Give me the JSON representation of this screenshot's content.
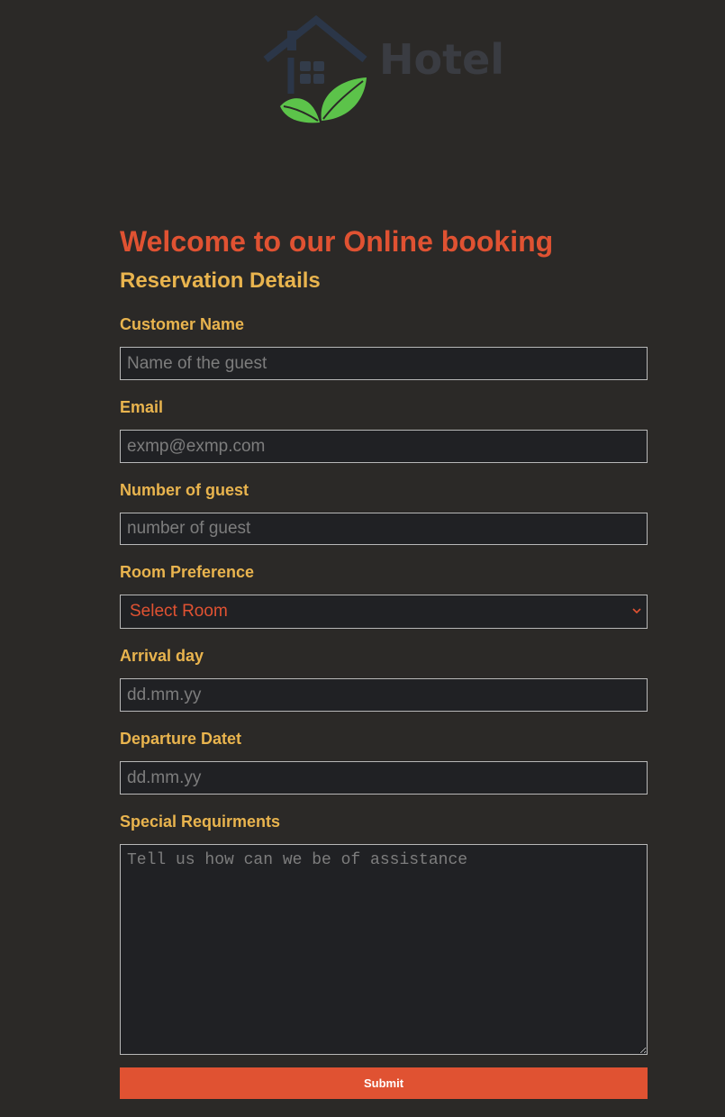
{
  "logo": {
    "text": "Hotel",
    "icon": "house-leaf-logo"
  },
  "header": {
    "welcome": "Welcome to our Online booking",
    "section_title": "Reservation Details"
  },
  "form": {
    "customer_name": {
      "label": "Customer Name",
      "placeholder": "Name of the guest"
    },
    "email": {
      "label": "Email",
      "placeholder": "exmp@exmp.com"
    },
    "guests": {
      "label": "Number of guest",
      "placeholder": "number of guest"
    },
    "room": {
      "label": "Room Preference",
      "selected": "Select Room"
    },
    "arrival": {
      "label": "Arrival day",
      "placeholder": "dd.mm.yy"
    },
    "departure": {
      "label": "Departure Datet",
      "placeholder": "dd.mm.yy"
    },
    "special": {
      "label": "Special Requirments",
      "placeholder": "Tell us how can we be of assistance"
    },
    "submit_label": "Submit"
  },
  "colors": {
    "background": "#2b2927",
    "accent_red": "#e05232",
    "label_gold": "#e9b44e",
    "input_bg": "#202124",
    "logo_navy": "#2b3648",
    "leaf_green": "#5cc34a"
  }
}
